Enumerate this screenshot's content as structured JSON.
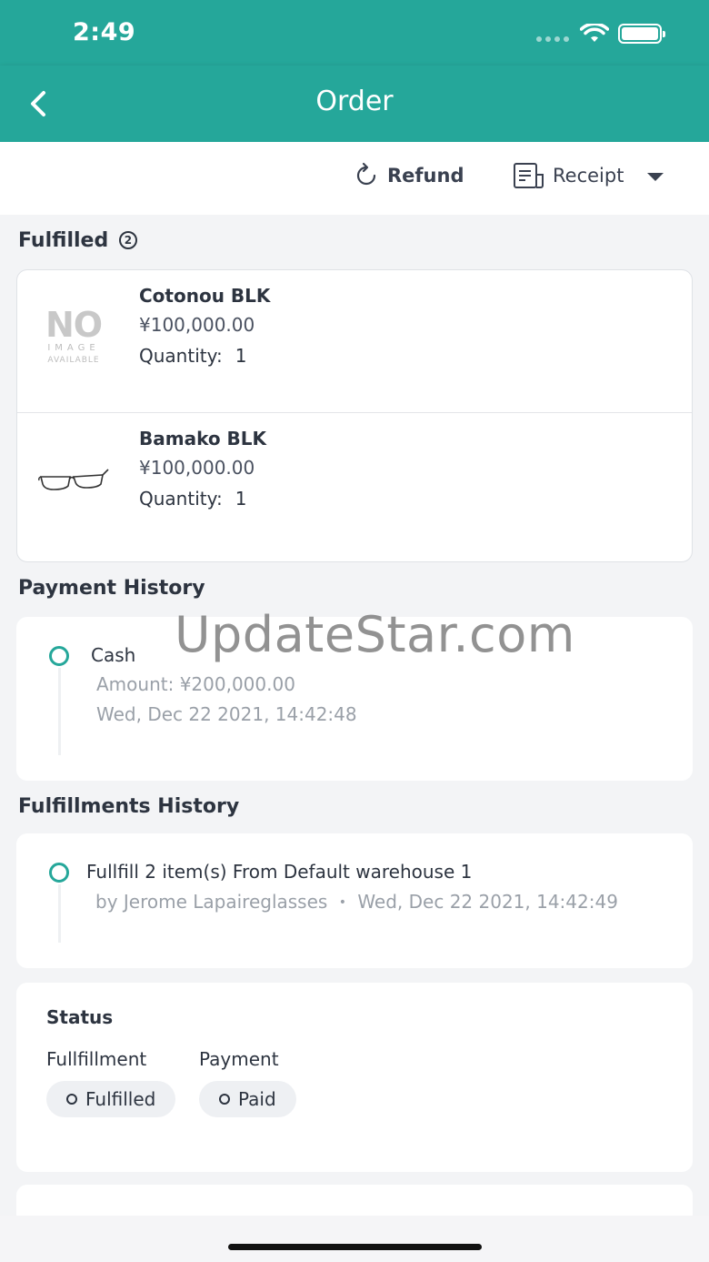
{
  "status_bar": {
    "time": "2:49",
    "wifi_icon": "wifi-icon",
    "battery_icon": "battery-icon"
  },
  "nav": {
    "title": "Order",
    "back_icon": "chevron-left-icon"
  },
  "actions": {
    "refund_label": "Refund",
    "receipt_label": "Receipt"
  },
  "fulfilled": {
    "title": "Fulfilled",
    "count": "2",
    "items": [
      {
        "name": "Cotonou BLK",
        "price": "¥100,000.00",
        "quantity_label": "Quantity:",
        "quantity": "1",
        "image": "no-image-placeholder",
        "placeholder_text": {
          "big": "NO",
          "mid": "IMAGE",
          "small": "AVAILABLE"
        }
      },
      {
        "name": "Bamako BLK",
        "price": "¥100,000.00",
        "quantity_label": "Quantity:",
        "quantity": "1",
        "image": "eyeglasses-icon"
      }
    ]
  },
  "payment_history": {
    "title": "Payment History",
    "entries": [
      {
        "method": "Cash",
        "amount": "Amount: ¥200,000.00",
        "datetime": "Wed, Dec 22 2021, 14:42:48"
      }
    ]
  },
  "watermark": "UpdateStar.com",
  "fulfillments_history": {
    "title": "Fulfillments History",
    "entries": [
      {
        "description": "Fullfill 2 item(s) From Default warehouse 1",
        "by": "by Jerome Lapaireglasses",
        "separator": "•",
        "datetime": "Wed, Dec 22 2021, 14:42:49"
      }
    ]
  },
  "status": {
    "title": "Status",
    "fulfillment_label": "Fullfillment",
    "fulfillment_value": "Fulfilled",
    "payment_label": "Payment",
    "payment_value": "Paid"
  },
  "colors": {
    "primary": "#25a79a",
    "background": "#f3f4f6",
    "text": "#2d3440",
    "muted": "#9aa0a8"
  }
}
